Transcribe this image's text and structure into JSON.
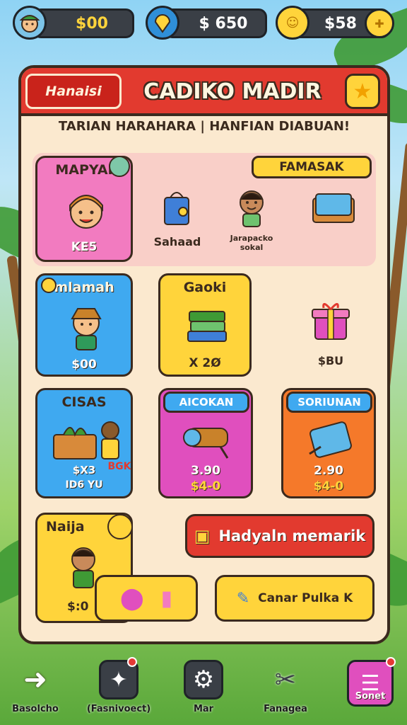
{
  "top_bar": {
    "coins_left": "$00",
    "gems": "$ 650",
    "coins_right": "$58"
  },
  "panel": {
    "tab_label": "Hanaisi",
    "title": "CADIKO MADIR",
    "subtitle": "TARIAN HARAHARA | HANFIAN DIABUAN!"
  },
  "row1": {
    "featured_title": "MAPYAI",
    "featured_label": "KE5",
    "ribbon": "FAMASAK",
    "items": [
      {
        "label": "Sahaad"
      },
      {
        "label": "Jarapacko sokal"
      },
      {
        "label": ""
      }
    ]
  },
  "row2": {
    "card1_title": "mlamah",
    "card1_price": "$00",
    "card2_title": "Gaoki",
    "card2_price": "X 2Ø",
    "gift_label": "$BU"
  },
  "row3": {
    "card1_title": "CISAS",
    "card1_price": "$X3",
    "card1_sub": "ID6 YU",
    "card1_tag": "BGK",
    "card2_title": "AICOKAN",
    "card2_price": "3.90",
    "card2_sub": "$4-0",
    "card3_title": "SORIUNAN",
    "card3_price": "2.90",
    "card3_sub": "$4-0"
  },
  "row4": {
    "card_title": "Naija",
    "card_price": "$:0",
    "main_button": "Hadyaln memarik",
    "secondary_button": "Canar Pulka K"
  },
  "nav": [
    {
      "label": "Basolcho",
      "icon": "back-arrow-icon"
    },
    {
      "label": "(Fasnivoect)",
      "icon": "shop-bag-icon"
    },
    {
      "label": "Mar",
      "icon": "gear-icon"
    },
    {
      "label": "Fanagea",
      "icon": "tools-icon"
    },
    {
      "label": "Sonet",
      "icon": "menu-list-icon"
    }
  ],
  "colors": {
    "header_red": "#e23a2f",
    "panel_cream": "#fbe9cf",
    "pink": "#f27bc0",
    "blue": "#3fa9f0",
    "yellow": "#ffd43b",
    "magenta": "#e04fbe",
    "orange": "#f5792a"
  }
}
